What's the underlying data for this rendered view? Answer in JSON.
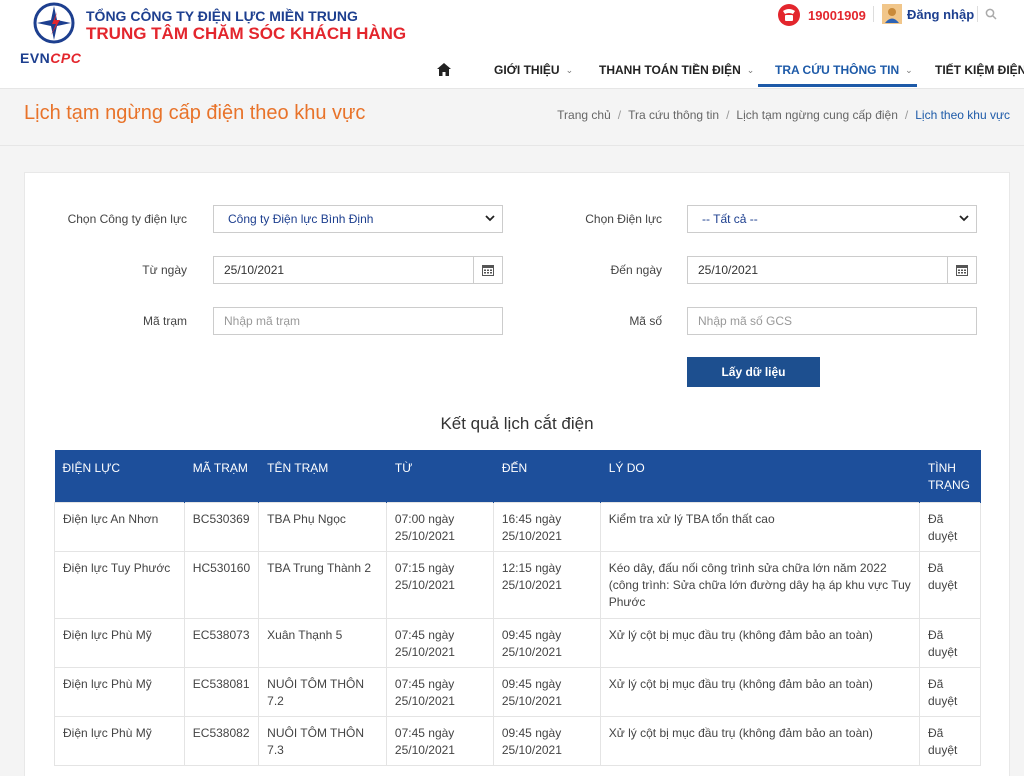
{
  "brand": {
    "company_line1": "TỔNG CÔNG TY ĐIỆN LỰC MIỀN TRUNG",
    "company_line2": "TRUNG TÂM CHĂM SÓC KHÁCH HÀNG",
    "logo_evn": "EVN",
    "logo_cpc": "CPC"
  },
  "topbar": {
    "hotline": "19001909",
    "login_label": "Đăng nhập"
  },
  "nav": {
    "items": [
      {
        "label": "GIỚI THIỆU"
      },
      {
        "label": "THANH TOÁN TIỀN ĐIỆN"
      },
      {
        "label": "TRA CỨU THÔNG TIN"
      },
      {
        "label": "TIẾT KIỆM ĐIỆN"
      }
    ],
    "chevron": "⌄"
  },
  "page": {
    "title": "Lịch tạm ngừng cấp điện theo khu vực",
    "breadcrumb": [
      "Trang chủ",
      "Tra cứu thông tin",
      "Lịch tạm ngừng cung cấp điện",
      "Lịch theo khu vực"
    ],
    "breadcrumb_sep": "/"
  },
  "form": {
    "company_label": "Chọn Công ty điện lực",
    "company_value": "Công ty Điện lực Bình Định",
    "unit_label": "Chọn Điện lực",
    "unit_value": "-- Tất cả --",
    "from_label": "Từ ngày",
    "from_value": "25/10/2021",
    "to_label": "Đến ngày",
    "to_value": "25/10/2021",
    "station_label": "Mã trạm",
    "station_placeholder": "Nhập mã trạm",
    "code_label": "Mã số",
    "code_placeholder": "Nhập mã số GCS",
    "submit_label": "Lấy dữ liệu"
  },
  "results": {
    "title": "Kết quả lịch cắt điện",
    "headers": [
      "ĐIỆN LỰC",
      "MÃ TRẠM",
      "TÊN TRẠM",
      "TỪ",
      "ĐẾN",
      "LÝ DO",
      "TÌNH TRẠNG"
    ],
    "rows": [
      {
        "unit": "Điện lực An Nhơn",
        "code": "BC530369",
        "station": "TBA Phụ Ngọc",
        "from": "07:00 ngày 25/10/2021",
        "to": "16:45 ngày 25/10/2021",
        "reason": "Kiểm tra xử lý TBA tổn thất cao",
        "status": "Đã duyệt"
      },
      {
        "unit": "Điện lực Tuy Phước",
        "code": "HC530160",
        "station": "TBA Trung Thành 2",
        "from": "07:15 ngày 25/10/2021",
        "to": "12:15 ngày 25/10/2021",
        "reason": "Kéo dây, đấu nối công trình sửa chữa lớn năm 2022 (công trình: Sửa chữa lớn đường dây hạ áp khu vực Tuy Phước",
        "status": "Đã duyệt"
      },
      {
        "unit": "Điện lực Phù Mỹ",
        "code": "EC538073",
        "station": "Xuân Thạnh 5",
        "from": "07:45 ngày 25/10/2021",
        "to": "09:45 ngày 25/10/2021",
        "reason": "Xử lý cột bị mục đầu trụ (không đảm bảo an toàn)",
        "status": "Đã duyệt"
      },
      {
        "unit": "Điện lực Phù Mỹ",
        "code": "EC538081",
        "station": "NUÔI TÔM THÔN 7.2",
        "from": "07:45 ngày 25/10/2021",
        "to": "09:45 ngày 25/10/2021",
        "reason": "Xử lý cột bị mục đầu trụ (không đảm bảo an toàn)",
        "status": "Đã duyệt"
      },
      {
        "unit": "Điện lực Phù Mỹ",
        "code": "EC538082",
        "station": "NUÔI TÔM THÔN 7.3",
        "from": "07:45 ngày 25/10/2021",
        "to": "09:45 ngày 25/10/2021",
        "reason": "Xử lý cột bị mục đầu trụ (không đảm bảo an toàn)",
        "status": "Đã duyệt"
      }
    ]
  },
  "colors": {
    "brand_blue": "#1d3f8f",
    "brand_red": "#e3262d",
    "title_orange": "#e8732a",
    "table_header": "#1d4f9b"
  }
}
